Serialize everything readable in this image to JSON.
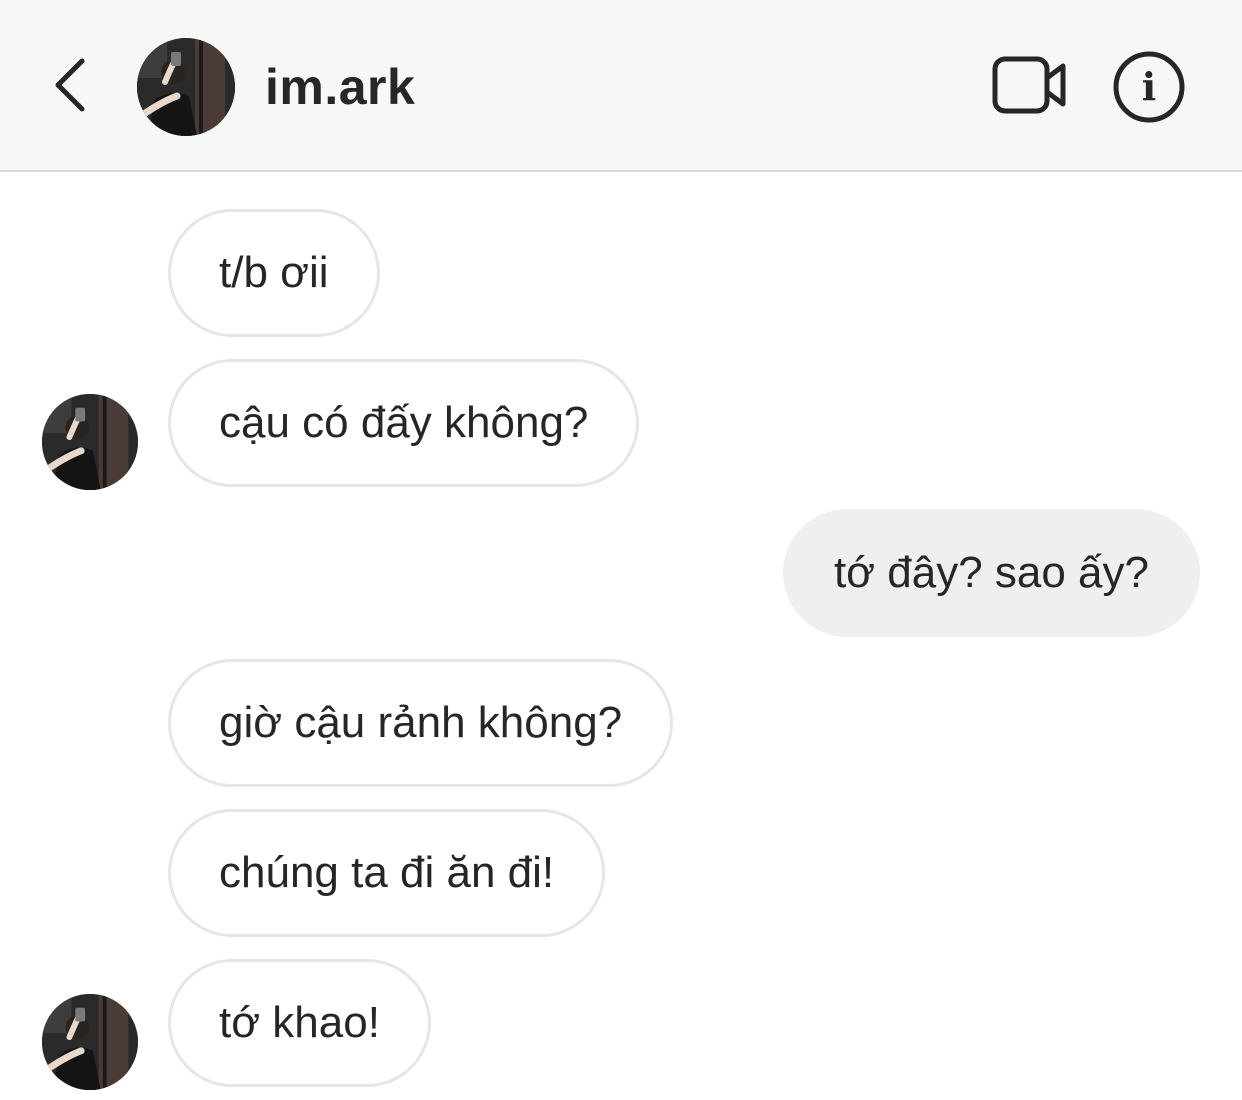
{
  "header": {
    "username": "im.ark",
    "back_icon": "chevron-left-icon",
    "video_icon": "video-camera-icon",
    "info_icon": "info-icon",
    "info_glyph": "i"
  },
  "messages": [
    {
      "text": "t/b ơii",
      "side": "incoming"
    },
    {
      "text": "cậu có đấy không?",
      "side": "incoming"
    },
    {
      "text": "tớ đây? sao ấy?",
      "side": "outgoing"
    },
    {
      "text": "giờ cậu rảnh không?",
      "side": "incoming"
    },
    {
      "text": "chúng ta đi ăn đi!",
      "side": "incoming"
    },
    {
      "text": "tớ khao!",
      "side": "incoming"
    }
  ],
  "colors": {
    "header_bg": "#f7f7f7",
    "incoming_bubble_bg": "#ffffff",
    "incoming_bubble_border": "#e6e6e6",
    "outgoing_bubble_bg": "#efefef",
    "text": "#262626"
  }
}
